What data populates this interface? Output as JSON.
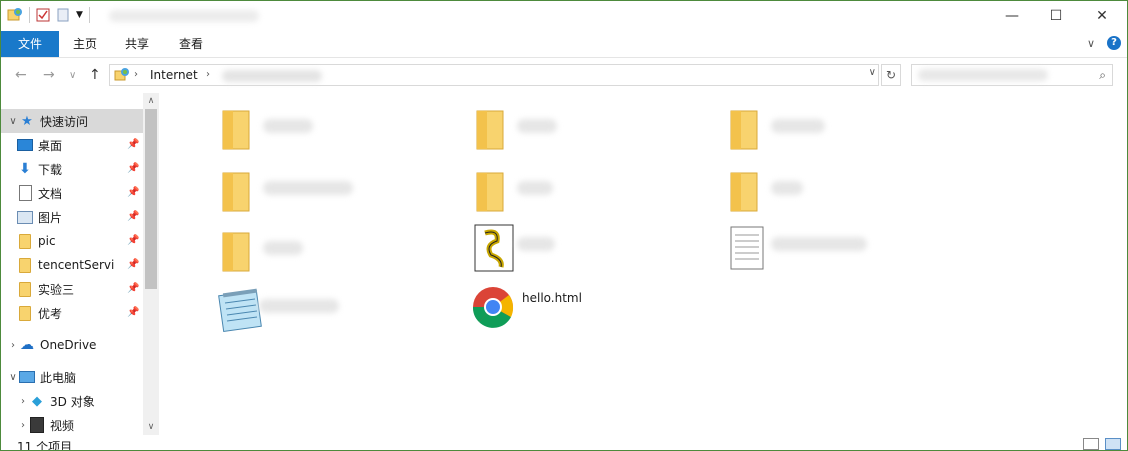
{
  "ribbon": {
    "tabs": [
      "文件",
      "主页",
      "共享",
      "查看"
    ]
  },
  "address": {
    "crumb": "Internet"
  },
  "nav_pane": {
    "quick_access": "快速访问",
    "pinned": [
      "桌面",
      "下载",
      "文档",
      "图片",
      "pic",
      "tencentServi",
      "实验三",
      "优考"
    ],
    "onedrive": "OneDrive",
    "this_pc": "此电脑",
    "pc_children": [
      "3D 对象",
      "视频"
    ]
  },
  "content": {
    "visible_file": "hello.html"
  },
  "status": {
    "count": "11 个项目"
  },
  "colors": {
    "accent": "#1979ca",
    "folder": "#f8d36e",
    "window_border": "#4d8a3c"
  }
}
